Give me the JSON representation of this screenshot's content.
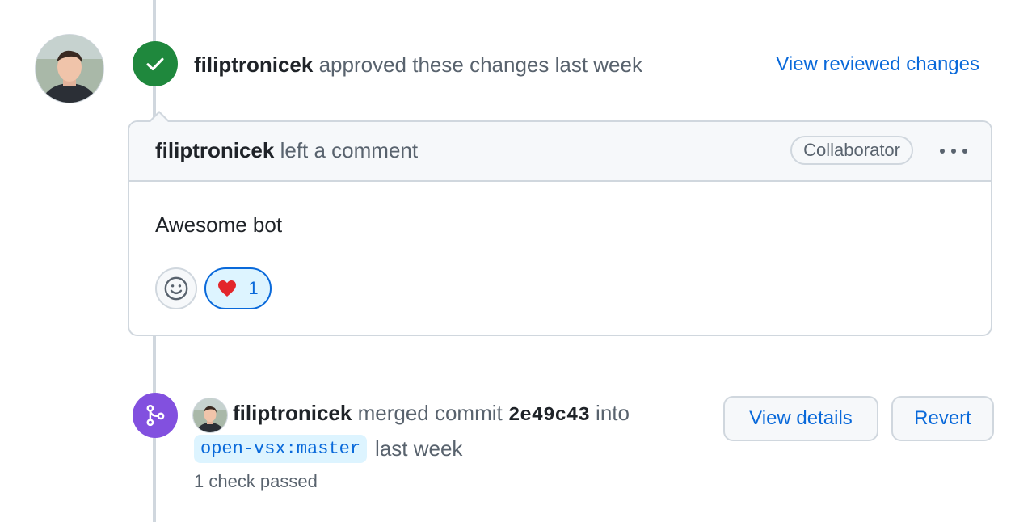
{
  "review": {
    "author": "filiptronicek",
    "action": "approved these changes last week",
    "view_reviewed": "View reviewed changes"
  },
  "comment": {
    "author": "filiptronicek",
    "action": "left a comment",
    "role": "Collaborator",
    "body": "Awesome bot",
    "reaction": {
      "emoji": "❤️",
      "count": "1"
    }
  },
  "merge": {
    "author": "filiptronicek",
    "action": "merged commit",
    "sha": "2e49c43",
    "into": "into",
    "branch": "open-vsx:master",
    "time": "last week",
    "checks": "1 check passed",
    "view_details": "View details",
    "revert": "Revert"
  },
  "colors": {
    "approved": "#1f883d",
    "merged": "#8250df",
    "link": "#0969da",
    "muted": "#59636e",
    "border": "#d0d7de"
  }
}
